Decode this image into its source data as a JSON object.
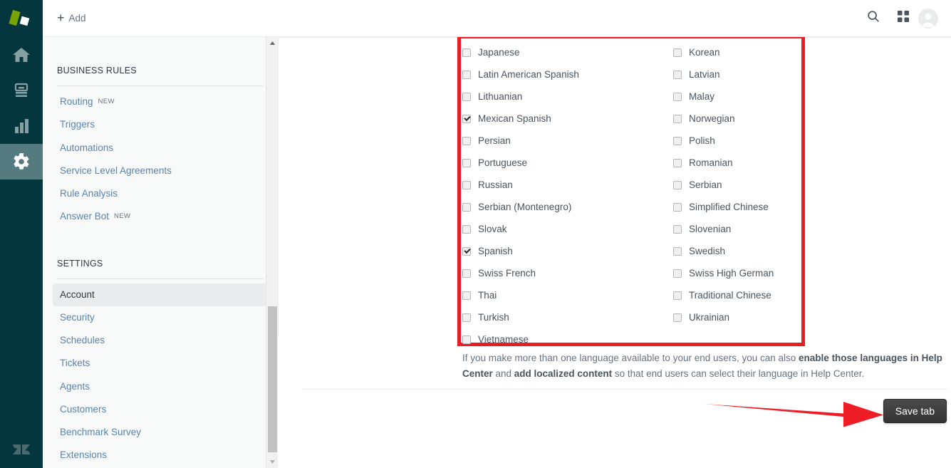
{
  "brand": {
    "accent_green": "#78a300",
    "rail_bg": "#03363d",
    "rail_active": "#557a80",
    "annotation_red": "#ec1c24",
    "link_blue": "#5a83ad"
  },
  "rail": {
    "logo_name": "zendesk-logo",
    "items": [
      {
        "name": "home-icon",
        "label": "Home",
        "active": false
      },
      {
        "name": "knowledge-base-icon",
        "label": "Knowledge base",
        "active": false
      },
      {
        "name": "reporting-icon",
        "label": "Reporting",
        "active": false
      },
      {
        "name": "settings-gear-icon",
        "label": "Settings",
        "active": true
      }
    ],
    "footer_logo_name": "zendesk-z-logo"
  },
  "topbar": {
    "add_label": "Add",
    "add_plus": "+",
    "icons": [
      {
        "name": "search-icon",
        "label": "Search"
      },
      {
        "name": "products-grid-icon",
        "label": "Zendesk Products"
      },
      {
        "name": "avatar",
        "label": "User profile"
      }
    ]
  },
  "sidebar": {
    "sections": [
      {
        "title": "BUSINESS RULES",
        "items": [
          {
            "label": "Routing",
            "badge": "NEW",
            "active": false
          },
          {
            "label": "Triggers",
            "badge": "",
            "active": false
          },
          {
            "label": "Automations",
            "badge": "",
            "active": false
          },
          {
            "label": "Service Level Agreements",
            "badge": "",
            "active": false
          },
          {
            "label": "Rule Analysis",
            "badge": "",
            "active": false
          },
          {
            "label": "Answer Bot",
            "badge": "NEW",
            "active": false
          }
        ]
      },
      {
        "title": "SETTINGS",
        "items": [
          {
            "label": "Account",
            "badge": "",
            "active": true
          },
          {
            "label": "Security",
            "badge": "",
            "active": false
          },
          {
            "label": "Schedules",
            "badge": "",
            "active": false
          },
          {
            "label": "Tickets",
            "badge": "",
            "active": false
          },
          {
            "label": "Agents",
            "badge": "",
            "active": false
          },
          {
            "label": "Customers",
            "badge": "",
            "active": false
          },
          {
            "label": "Benchmark Survey",
            "badge": "",
            "active": false
          },
          {
            "label": "Extensions",
            "badge": "",
            "active": false
          }
        ]
      }
    ]
  },
  "main": {
    "languages_left": [
      {
        "label": "Japanese",
        "checked": false
      },
      {
        "label": "Latin American Spanish",
        "checked": false
      },
      {
        "label": "Lithuanian",
        "checked": false
      },
      {
        "label": "Mexican Spanish",
        "checked": true
      },
      {
        "label": "Persian",
        "checked": false
      },
      {
        "label": "Portuguese",
        "checked": false
      },
      {
        "label": "Russian",
        "checked": false
      },
      {
        "label": "Serbian (Montenegro)",
        "checked": false
      },
      {
        "label": "Slovak",
        "checked": false
      },
      {
        "label": "Spanish",
        "checked": true
      },
      {
        "label": "Swiss French",
        "checked": false
      },
      {
        "label": "Thai",
        "checked": false
      },
      {
        "label": "Turkish",
        "checked": false
      },
      {
        "label": "Vietnamese",
        "checked": false
      }
    ],
    "languages_right": [
      {
        "label": "Korean",
        "checked": false
      },
      {
        "label": "Latvian",
        "checked": false
      },
      {
        "label": "Malay",
        "checked": false
      },
      {
        "label": "Norwegian",
        "checked": false
      },
      {
        "label": "Polish",
        "checked": false
      },
      {
        "label": "Romanian",
        "checked": false
      },
      {
        "label": "Serbian",
        "checked": false
      },
      {
        "label": "Simplified Chinese",
        "checked": false
      },
      {
        "label": "Slovenian",
        "checked": false
      },
      {
        "label": "Swedish",
        "checked": false
      },
      {
        "label": "Swiss High German",
        "checked": false
      },
      {
        "label": "Traditional Chinese",
        "checked": false
      },
      {
        "label": "Ukrainian",
        "checked": false
      }
    ],
    "help_note": {
      "part1": "If you make more than one language available to your end users, you can also ",
      "link1": "enable those languages in Help Center",
      "part2": " and ",
      "link2": "add localized content",
      "part3": " so that end users can select their language in Help Center."
    },
    "save_label": "Save tab"
  }
}
